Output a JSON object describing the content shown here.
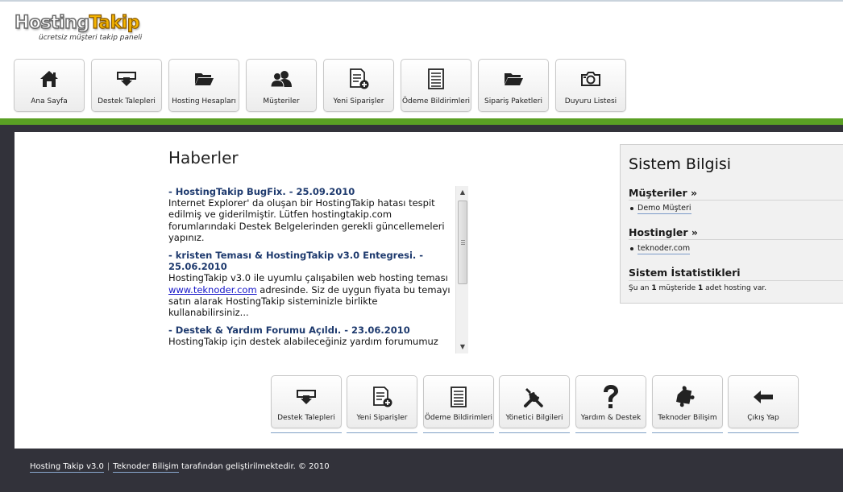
{
  "logo": {
    "part1": "Hosting",
    "part2": "Takip",
    "tagline": "ücretsiz müşteri takip paneli"
  },
  "topnav": [
    {
      "label": "Ana Sayfa",
      "icon": "home-icon"
    },
    {
      "label": "Destek Talepleri",
      "icon": "support-inbox-icon"
    },
    {
      "label": "Hosting Hesapları",
      "icon": "folder-icon"
    },
    {
      "label": "Müşteriler",
      "icon": "users-icon"
    },
    {
      "label": "Yeni Siparişler",
      "icon": "new-document-icon"
    },
    {
      "label": "Ödeme Bildirimleri",
      "icon": "document-icon"
    },
    {
      "label": "Sipariş Paketleri",
      "icon": "folder-icon"
    },
    {
      "label": "Duyuru Listesi",
      "icon": "camera-icon"
    }
  ],
  "news": {
    "title": "Haberler",
    "items": [
      {
        "headline": "- HostingTakip BugFix. - 25.09.2010",
        "body": "Internet Explorer' da oluşan bir HostingTakip hatası tespit edilmiş ve giderilmiştir. Lütfen hostingtakip.com forumlarındaki Destek Belgelerinden gerekli güncellemeleri yapınız.",
        "link": "",
        "body_after": ""
      },
      {
        "headline": "- kristen Teması & HostingTakip v3.0 Entegresi. - 25.06.2010",
        "body": "HostingTakip v3.0 ile uyumlu çalışabilen web hosting teması ",
        "link": "www.teknoder.com",
        "body_after": " adresinde. Siz de uygun fiyata bu temayı satın alarak HostingTakip sisteminizle birlikte kullanabilirsiniz..."
      },
      {
        "headline": "- Destek & Yardım Forumu Açıldı. - 23.06.2010",
        "body": "HostingTakip için destek alabileceğiniz yardım forumumuz",
        "link": "",
        "body_after": ""
      }
    ]
  },
  "sysinfo": {
    "title": "Sistem Bilgisi",
    "customers_heading": "Müşteriler »",
    "customers": [
      "Demo Müşteri"
    ],
    "hostings_heading": "Hostingler »",
    "hostings": [
      "teknoder.com"
    ],
    "stats_heading": "Sistem İstatistikleri",
    "stats_pre": "Şu an ",
    "stats_customers": "1",
    "stats_mid": " müşteride ",
    "stats_hostings": "1",
    "stats_post": " adet hosting var."
  },
  "bottomnav": [
    {
      "label": "Destek Talepleri",
      "icon": "support-inbox-icon"
    },
    {
      "label": "Yeni Siparişler",
      "icon": "new-document-icon"
    },
    {
      "label": "Ödeme Bildirimleri",
      "icon": "document-icon"
    },
    {
      "label": "Yönetici Bilgileri",
      "icon": "tools-icon"
    },
    {
      "label": "Yardım & Destek",
      "icon": "question-icon"
    },
    {
      "label": "Teknoder Bilişim",
      "icon": "puzzle-icon"
    },
    {
      "label": "Çıkış Yap",
      "icon": "arrow-left-icon"
    }
  ],
  "footer": {
    "product": "Hosting Takip v3.0",
    "separator": "|",
    "company": "Teknoder Bilişim",
    "suffix": " tarafından geliştirilmektedir. © 2010"
  },
  "colors": {
    "accent_green": "#5aa024",
    "dark_background": "#32323a",
    "headline_blue": "#1e3a6e"
  }
}
